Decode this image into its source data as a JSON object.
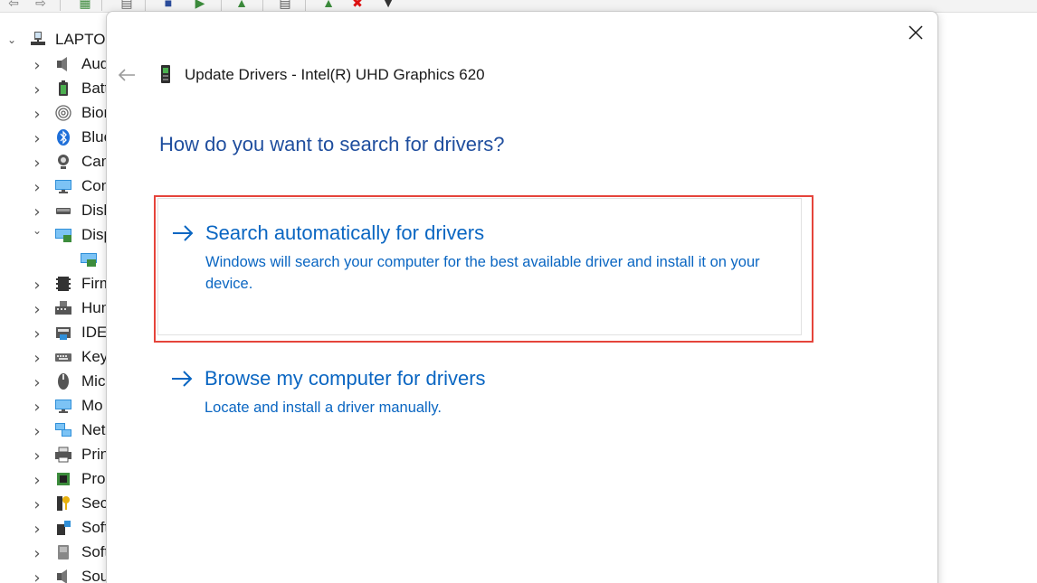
{
  "device_manager": {
    "root_label": "LAPTOP",
    "tree_items": [
      {
        "label": "Aud",
        "icon": "speaker-icon",
        "expanded": false
      },
      {
        "label": "Batt",
        "icon": "battery-icon",
        "expanded": false
      },
      {
        "label": "Biom",
        "icon": "fingerprint-icon",
        "expanded": false
      },
      {
        "label": "Blue",
        "icon": "bluetooth-icon",
        "expanded": false
      },
      {
        "label": "Cam",
        "icon": "camera-icon",
        "expanded": false
      },
      {
        "label": "Com",
        "icon": "monitor-icon",
        "expanded": false
      },
      {
        "label": "Disk",
        "icon": "disk-icon",
        "expanded": false
      },
      {
        "label": "Disp",
        "icon": "display-adapter-icon",
        "expanded": true
      },
      {
        "label": "",
        "icon": "display-adapter-child-icon",
        "expanded": false
      },
      {
        "label": "Firm",
        "icon": "chip-icon",
        "expanded": false
      },
      {
        "label": "Hum",
        "icon": "keyboard-hid-icon",
        "expanded": false
      },
      {
        "label": "IDE",
        "icon": "ide-icon",
        "expanded": false
      },
      {
        "label": "Key",
        "icon": "keyboard-icon",
        "expanded": false
      },
      {
        "label": "Mic",
        "icon": "mouse-icon",
        "expanded": false
      },
      {
        "label": "Mo",
        "icon": "monitor-icon",
        "expanded": false
      },
      {
        "label": "Net",
        "icon": "network-icon",
        "expanded": false
      },
      {
        "label": "Prin",
        "icon": "printer-icon",
        "expanded": false
      },
      {
        "label": "Pro",
        "icon": "processor-icon",
        "expanded": false
      },
      {
        "label": "Sec",
        "icon": "security-key-icon",
        "expanded": false
      },
      {
        "label": "Soft",
        "icon": "software-component-icon",
        "expanded": false
      },
      {
        "label": "Soft",
        "icon": "software-device-icon",
        "expanded": false
      },
      {
        "label": "Sou",
        "icon": "sound-icon",
        "expanded": false
      }
    ]
  },
  "dialog": {
    "title": "Update Drivers - Intel(R) UHD Graphics 620",
    "question": "How do you want to search for drivers?",
    "options": [
      {
        "title": "Search automatically for drivers",
        "description": "Windows will search your computer for the best available driver and install it on your device.",
        "highlighted": true
      },
      {
        "title": "Browse my computer for drivers",
        "description": "Locate and install a driver manually.",
        "highlighted": false
      }
    ]
  },
  "colors": {
    "accent_link": "#0a66c2",
    "heading": "#1f4e9e",
    "highlight_border": "#e5443b"
  }
}
